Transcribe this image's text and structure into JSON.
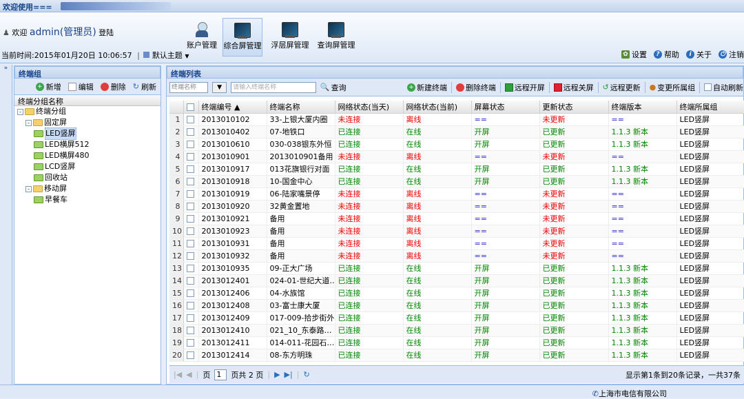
{
  "title": "欢迎使用===",
  "user": {
    "welcome": "欢迎",
    "name": "admin(管理员)",
    "login": "登陆"
  },
  "time_label": "当前时间:2015年01月20日 10:06:57",
  "theme_label": "默认主题",
  "nav": [
    "账户管理",
    "综合屏管理",
    "浮层屏管理",
    "查询屏管理"
  ],
  "top_tools": [
    "设置",
    "帮助",
    "关于",
    "注销"
  ],
  "left": {
    "title": "终端组",
    "tools": [
      "新增",
      "编辑",
      "删除",
      "刷新"
    ],
    "col": "终端分组名称",
    "tree": [
      {
        "label": "终端分组",
        "level": 0,
        "type": "folder",
        "exp": "-"
      },
      {
        "label": "固定屏",
        "level": 1,
        "type": "folder",
        "exp": "-"
      },
      {
        "label": "LED竖屏",
        "level": 2,
        "type": "leaf",
        "selected": true
      },
      {
        "label": "LED横屏512",
        "level": 2,
        "type": "leaf"
      },
      {
        "label": "LED横屏480",
        "level": 2,
        "type": "leaf"
      },
      {
        "label": "LCD竖屏",
        "level": 2,
        "type": "leaf"
      },
      {
        "label": "回收站",
        "level": 2,
        "type": "leaf"
      },
      {
        "label": "移动屏",
        "level": 1,
        "type": "folder",
        "exp": "-"
      },
      {
        "label": "早餐车",
        "level": 2,
        "type": "leaf"
      }
    ]
  },
  "right": {
    "title": "终端列表",
    "search_select": "终端名称",
    "search_placeholder": "请输入终端名称",
    "tools": [
      "查询",
      "新建终端",
      "删除终端",
      "远程开屏",
      "远程关屏",
      "远程更新",
      "变更所属组",
      "自动刷新"
    ],
    "columns": [
      "终端编号 ▲",
      "终端名称",
      "网络状态(当天)",
      "网络状态(当前)",
      "屏幕状态",
      "更新状态",
      "终端版本",
      "终端所属组"
    ],
    "rows": [
      [
        "2013010102",
        "33-上银大厦内圈",
        "未连接",
        "离线",
        "==",
        "未更新",
        "==",
        "LED竖屏"
      ],
      [
        "2013010402",
        "07-地铁口",
        "已连接",
        "在线",
        "开屏",
        "已更新",
        "1.1.3 新本",
        "LED竖屏"
      ],
      [
        "2013010610",
        "030-038银东外恒",
        "已连接",
        "在线",
        "开屏",
        "已更新",
        "1.1.3 新本",
        "LED竖屏"
      ],
      [
        "2013010901",
        "2013010901备用",
        "未连接",
        "离线",
        "==",
        "未更新",
        "==",
        "LED竖屏"
      ],
      [
        "2013010917",
        "013花旗银行对面",
        "已连接",
        "在线",
        "开屏",
        "已更新",
        "1.1.3 新本",
        "LED竖屏"
      ],
      [
        "2013010918",
        "10-国金中心",
        "已连接",
        "在线",
        "开屏",
        "已更新",
        "1.1.3 新本",
        "LED竖屏"
      ],
      [
        "2013010919",
        "06-陆家嘴景停",
        "未连接",
        "离线",
        "==",
        "未更新",
        "==",
        "LED竖屏"
      ],
      [
        "2013010920",
        "32黄金置地",
        "未连接",
        "离线",
        "==",
        "未更新",
        "==",
        "LED竖屏"
      ],
      [
        "2013010921",
        "备用",
        "未连接",
        "离线",
        "==",
        "未更新",
        "==",
        "LED竖屏"
      ],
      [
        "2013010923",
        "备用",
        "未连接",
        "离线",
        "==",
        "未更新",
        "==",
        "LED竖屏"
      ],
      [
        "2013010931",
        "备用",
        "未连接",
        "离线",
        "==",
        "未更新",
        "==",
        "LED竖屏"
      ],
      [
        "2013010932",
        "备用",
        "未连接",
        "离线",
        "==",
        "未更新",
        "==",
        "LED竖屏"
      ],
      [
        "2013010935",
        "09-正大广场",
        "已连接",
        "在线",
        "开屏",
        "已更新",
        "1.1.3 新本",
        "LED竖屏"
      ],
      [
        "2013012401",
        "024-01-世纪大道…",
        "已连接",
        "在线",
        "开屏",
        "已更新",
        "1.1.3 新本",
        "LED竖屏"
      ],
      [
        "2013012406",
        "04-水族馆",
        "已连接",
        "在线",
        "开屏",
        "已更新",
        "1.1.3 新本",
        "LED竖屏"
      ],
      [
        "2013012408",
        "03-富士康大厦",
        "已连接",
        "在线",
        "开屏",
        "已更新",
        "1.1.3 新本",
        "LED竖屏"
      ],
      [
        "2013012409",
        "017-009-拾步街外",
        "已连接",
        "在线",
        "开屏",
        "已更新",
        "1.1.3 新本",
        "LED竖屏"
      ],
      [
        "2013012410",
        "021_10_东泰路…",
        "已连接",
        "在线",
        "开屏",
        "已更新",
        "1.1.3 新本",
        "LED竖屏"
      ],
      [
        "2013012411",
        "014-011-花园石…",
        "已连接",
        "在线",
        "开屏",
        "已更新",
        "1.1.3 新本",
        "LED竖屏"
      ],
      [
        "2013012414",
        "08-东方明珠",
        "已连接",
        "在线",
        "开屏",
        "已更新",
        "1.1.3 新本",
        "LED竖屏"
      ]
    ],
    "pager": {
      "page_label": "页",
      "page": "1",
      "total": "页共 2 页",
      "info": "显示第1条到20条记录，一共37条"
    }
  },
  "footer": "上海市电信有限公司",
  "colors": {
    "accent": "#15428b",
    "border": "#99bbe8",
    "red": "#e00000",
    "green": "#008800"
  }
}
